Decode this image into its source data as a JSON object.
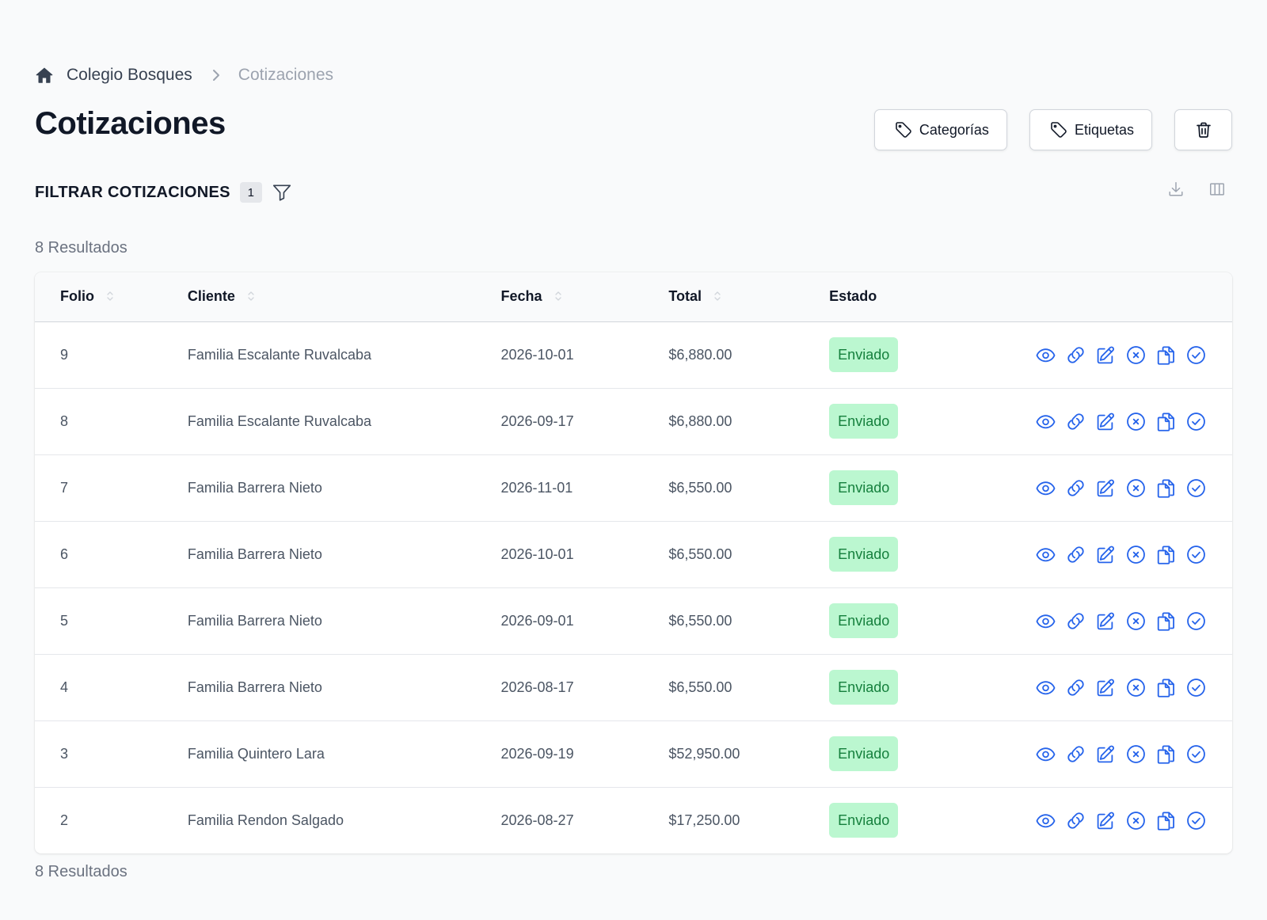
{
  "breadcrumb": {
    "home_icon": "home-icon",
    "school": "Colegio Bosques",
    "current": "Cotizaciones"
  },
  "page_title": "Cotizaciones",
  "header_actions": {
    "categorias_label": "Categorías",
    "etiquetas_label": "Etiquetas"
  },
  "filter": {
    "title": "FILTRAR COTIZACIONES",
    "count": "1"
  },
  "results_label": "8 Resultados",
  "table": {
    "columns": [
      "Folio",
      "Cliente",
      "Fecha",
      "Total",
      "Estado"
    ],
    "rows": [
      {
        "folio": "9",
        "cliente": "Familia Escalante Ruvalcaba",
        "fecha": "2026-10-01",
        "total": "$6,880.00",
        "estado": "Enviado"
      },
      {
        "folio": "8",
        "cliente": "Familia Escalante Ruvalcaba",
        "fecha": "2026-09-17",
        "total": "$6,880.00",
        "estado": "Enviado"
      },
      {
        "folio": "7",
        "cliente": "Familia Barrera Nieto",
        "fecha": "2026-11-01",
        "total": "$6,550.00",
        "estado": "Enviado"
      },
      {
        "folio": "6",
        "cliente": "Familia Barrera Nieto",
        "fecha": "2026-10-01",
        "total": "$6,550.00",
        "estado": "Enviado"
      },
      {
        "folio": "5",
        "cliente": "Familia Barrera Nieto",
        "fecha": "2026-09-01",
        "total": "$6,550.00",
        "estado": "Enviado"
      },
      {
        "folio": "4",
        "cliente": "Familia Barrera Nieto",
        "fecha": "2026-08-17",
        "total": "$6,550.00",
        "estado": "Enviado"
      },
      {
        "folio": "3",
        "cliente": "Familia Quintero Lara",
        "fecha": "2026-09-19",
        "total": "$52,950.00",
        "estado": "Enviado"
      },
      {
        "folio": "2",
        "cliente": "Familia Rendon Salgado",
        "fecha": "2026-08-27",
        "total": "$17,250.00",
        "estado": "Enviado"
      }
    ]
  },
  "colors": {
    "accent": "#2563eb",
    "badge_bg": "#bbf7d0",
    "badge_text": "#15803d"
  },
  "row_action_icons": [
    "eye-icon",
    "link-icon",
    "edit-icon",
    "cancel-circle-icon",
    "copy-icon",
    "check-circle-icon"
  ]
}
